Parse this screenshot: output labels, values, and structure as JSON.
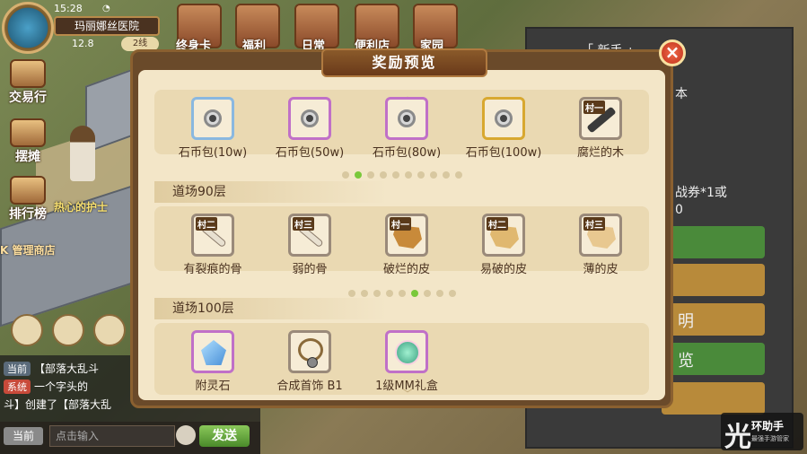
{
  "hud": {
    "time": "15:28",
    "location": "玛丽娜丝医院",
    "coords": "12.8",
    "line": "2线"
  },
  "top_menu": [
    "终身卡",
    "福利",
    "日常",
    "便利店",
    "家园"
  ],
  "left_menu": [
    "交易行",
    "摆摊",
    "排行榜"
  ],
  "npc_name": "热心的护士",
  "shop_label": "K 管理商店",
  "chat": {
    "lines": [
      {
        "tag": "当前",
        "text": "【部落大乱斗"
      },
      {
        "tag": "系统",
        "text": "一个字头的"
      },
      {
        "tag": "",
        "text": "斗】创建了【部落大乱"
      }
    ],
    "channel": "当前",
    "placeholder": "点击输入",
    "send_label": "发送"
  },
  "right_panel": {
    "title": "「 新手 」",
    "text_a": "本",
    "text_b": "战券*1或",
    "text_c": "0",
    "btn_d": "明",
    "btn_e": "览"
  },
  "modal": {
    "title": "奖励预览",
    "close_icon": "close-icon",
    "top_row": [
      {
        "tier": "",
        "name": "石币包(10w)",
        "icon": "coin-icon",
        "quality": "blue"
      },
      {
        "tier": "",
        "name": "石币包(50w)",
        "icon": "coin-icon",
        "quality": "purple"
      },
      {
        "tier": "",
        "name": "石币包(80w)",
        "icon": "coin-icon",
        "quality": "purple"
      },
      {
        "tier": "",
        "name": "石币包(100w)",
        "icon": "coin-icon",
        "quality": "gold"
      },
      {
        "tier": "村一",
        "name": "腐烂的木",
        "icon": "wood-icon",
        "quality": "gray"
      }
    ],
    "section_90": {
      "title": "道场90层",
      "items": [
        {
          "tier": "村二",
          "name": "有裂痕的骨",
          "icon": "bone-icon",
          "quality": "gray"
        },
        {
          "tier": "村三",
          "name": "弱的骨",
          "icon": "bone-icon",
          "quality": "gray"
        },
        {
          "tier": "村一",
          "name": "破烂的皮",
          "icon": "hide-icon",
          "quality": "gray"
        },
        {
          "tier": "村二",
          "name": "易破的皮",
          "icon": "hide-icon",
          "quality": "gray"
        },
        {
          "tier": "村三",
          "name": "薄的皮",
          "icon": "hide-icon",
          "quality": "gray"
        }
      ]
    },
    "section_100": {
      "title": "道场100层",
      "items": [
        {
          "tier": "",
          "name": "附灵石",
          "icon": "crystal-icon",
          "quality": "purple"
        },
        {
          "tier": "",
          "name": "合成首饰 B1",
          "icon": "necklace-icon",
          "quality": "gray"
        },
        {
          "tier": "",
          "name": "1级MM礼盒",
          "icon": "gift-box-icon",
          "quality": "purple"
        }
      ]
    }
  },
  "watermark": {
    "big": "光",
    "title": "环助手",
    "sub": "最强手游管家"
  }
}
